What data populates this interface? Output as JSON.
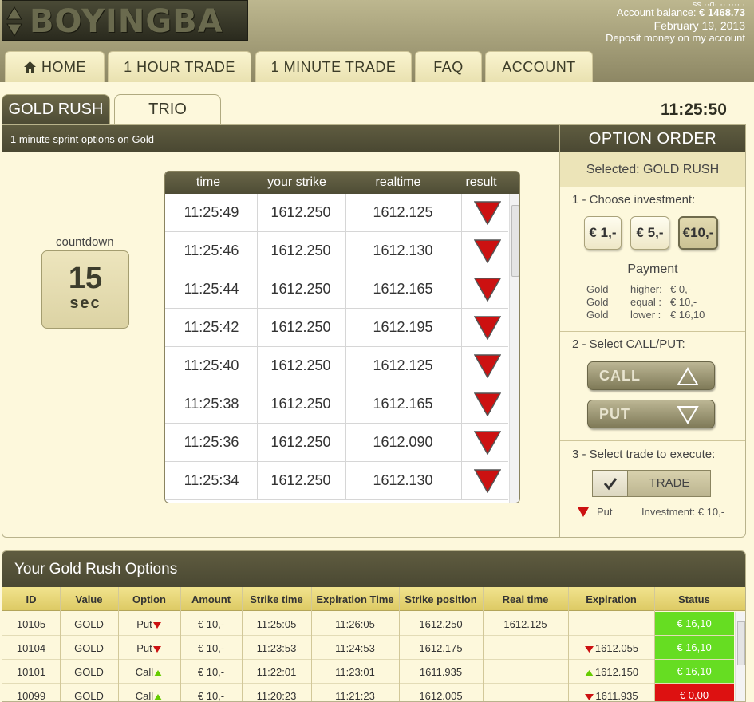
{
  "brand": {
    "logo_text": "BOYINGBA"
  },
  "account": {
    "name_partial": "ss  ··g· ·· ···· ·",
    "balance_label": "Account balance:",
    "balance_value": "€ 1468.73",
    "date": "February 19, 2013",
    "deposit_link": "Deposit money on my account"
  },
  "nav": [
    {
      "label": "HOME",
      "icon": "home-icon"
    },
    {
      "label": "1 HOUR TRADE"
    },
    {
      "label": "1 MINUTE TRADE"
    },
    {
      "label": "FAQ"
    },
    {
      "label": "ACCOUNT"
    }
  ],
  "product_tabs": {
    "active": "GOLD RUSH",
    "other": "TRIO"
  },
  "clock": "11:25:50",
  "main": {
    "strip_text": "1 minute sprint options on Gold",
    "countdown_label": "countdown",
    "countdown_value": "15",
    "countdown_unit": "sec"
  },
  "ticks": {
    "headers": [
      "time",
      "your strike",
      "realtime",
      "result"
    ],
    "rows": [
      {
        "time": "11:25:49",
        "strike": "1612.250",
        "realtime": "1612.125",
        "result": "down"
      },
      {
        "time": "11:25:46",
        "strike": "1612.250",
        "realtime": "1612.130",
        "result": "down"
      },
      {
        "time": "11:25:44",
        "strike": "1612.250",
        "realtime": "1612.165",
        "result": "down"
      },
      {
        "time": "11:25:42",
        "strike": "1612.250",
        "realtime": "1612.195",
        "result": "down"
      },
      {
        "time": "11:25:40",
        "strike": "1612.250",
        "realtime": "1612.125",
        "result": "down"
      },
      {
        "time": "11:25:38",
        "strike": "1612.250",
        "realtime": "1612.165",
        "result": "down"
      },
      {
        "time": "11:25:36",
        "strike": "1612.250",
        "realtime": "1612.090",
        "result": "down"
      },
      {
        "time": "11:25:34",
        "strike": "1612.250",
        "realtime": "1612.130",
        "result": "down"
      }
    ]
  },
  "order": {
    "title": "OPTION ORDER",
    "selected": "Selected: GOLD RUSH",
    "step1": "1 - Choose investment:",
    "investments": [
      "€ 1,-",
      "€ 5,-",
      "€10,-"
    ],
    "selected_investment": "€10,-",
    "payment_title": "Payment",
    "payment_rows": [
      {
        "asset": "Gold",
        "cond": "higher:",
        "amount": "€ 0,-"
      },
      {
        "asset": "Gold",
        "cond": "equal :",
        "amount": "€ 10,-"
      },
      {
        "asset": "Gold",
        "cond": "lower :",
        "amount": "€ 16,10"
      }
    ],
    "step2": "2 - Select CALL/PUT:",
    "call_label": "CALL",
    "put_label": "PUT",
    "step3": "3 - Select trade to execute:",
    "trade_label": "TRADE",
    "summary_direction": "Put",
    "summary_investment": "Investment: € 10,-"
  },
  "options_table": {
    "title": "Your Gold Rush Options",
    "headers": [
      "ID",
      "Value",
      "Option",
      "Amount",
      "Strike time",
      "Expiration Time",
      "Strike position",
      "Real time",
      "Expiration",
      "Status"
    ],
    "rows": [
      {
        "id": "10105",
        "value": "GOLD",
        "option": "Put",
        "option_dir": "down",
        "amount": "€ 10,-",
        "strike_time": "11:25:05",
        "exp_time": "11:26:05",
        "strike_pos": "1612.250",
        "real_time": "1612.125",
        "expiration": "",
        "exp_dir": "",
        "status": "€ 16,10",
        "status_color": "#66dd22"
      },
      {
        "id": "10104",
        "value": "GOLD",
        "option": "Put",
        "option_dir": "down",
        "amount": "€ 10,-",
        "strike_time": "11:23:53",
        "exp_time": "11:24:53",
        "strike_pos": "1612.175",
        "real_time": "",
        "expiration": "1612.055",
        "exp_dir": "down",
        "status": "€ 16,10",
        "status_color": "#66dd22"
      },
      {
        "id": "10101",
        "value": "GOLD",
        "option": "Call",
        "option_dir": "up",
        "amount": "€ 10,-",
        "strike_time": "11:22:01",
        "exp_time": "11:23:01",
        "strike_pos": "1611.935",
        "real_time": "",
        "expiration": "1612.150",
        "exp_dir": "up",
        "status": "€ 16,10",
        "status_color": "#66dd22"
      },
      {
        "id": "10099",
        "value": "GOLD",
        "option": "Call",
        "option_dir": "up",
        "amount": "€ 10,-",
        "strike_time": "11:20:23",
        "exp_time": "11:21:23",
        "strike_pos": "1612.005",
        "real_time": "",
        "expiration": "1611.935",
        "exp_dir": "down",
        "status": "€ 0,00",
        "status_color": "#dd1111"
      }
    ]
  },
  "colors": {
    "accent_dark": "#4e4c35",
    "background": "#fdf8dc",
    "down": "#cc1111",
    "up": "#66cc00"
  }
}
